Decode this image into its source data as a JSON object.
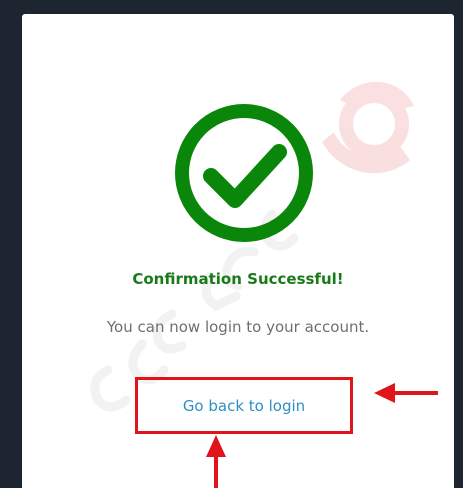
{
  "confirmation": {
    "title": "Confirmation Successful!",
    "message": "You can now login to your account.",
    "link_label": "Go back to login"
  },
  "colors": {
    "success": "#1a7a1a",
    "check_circle": "#0a870a",
    "link": "#2e8fc4",
    "annotation": "#e0141b",
    "background": "#1c2530"
  },
  "icons": {
    "status": "check-circle-icon",
    "annotation": "arrow-icon"
  }
}
